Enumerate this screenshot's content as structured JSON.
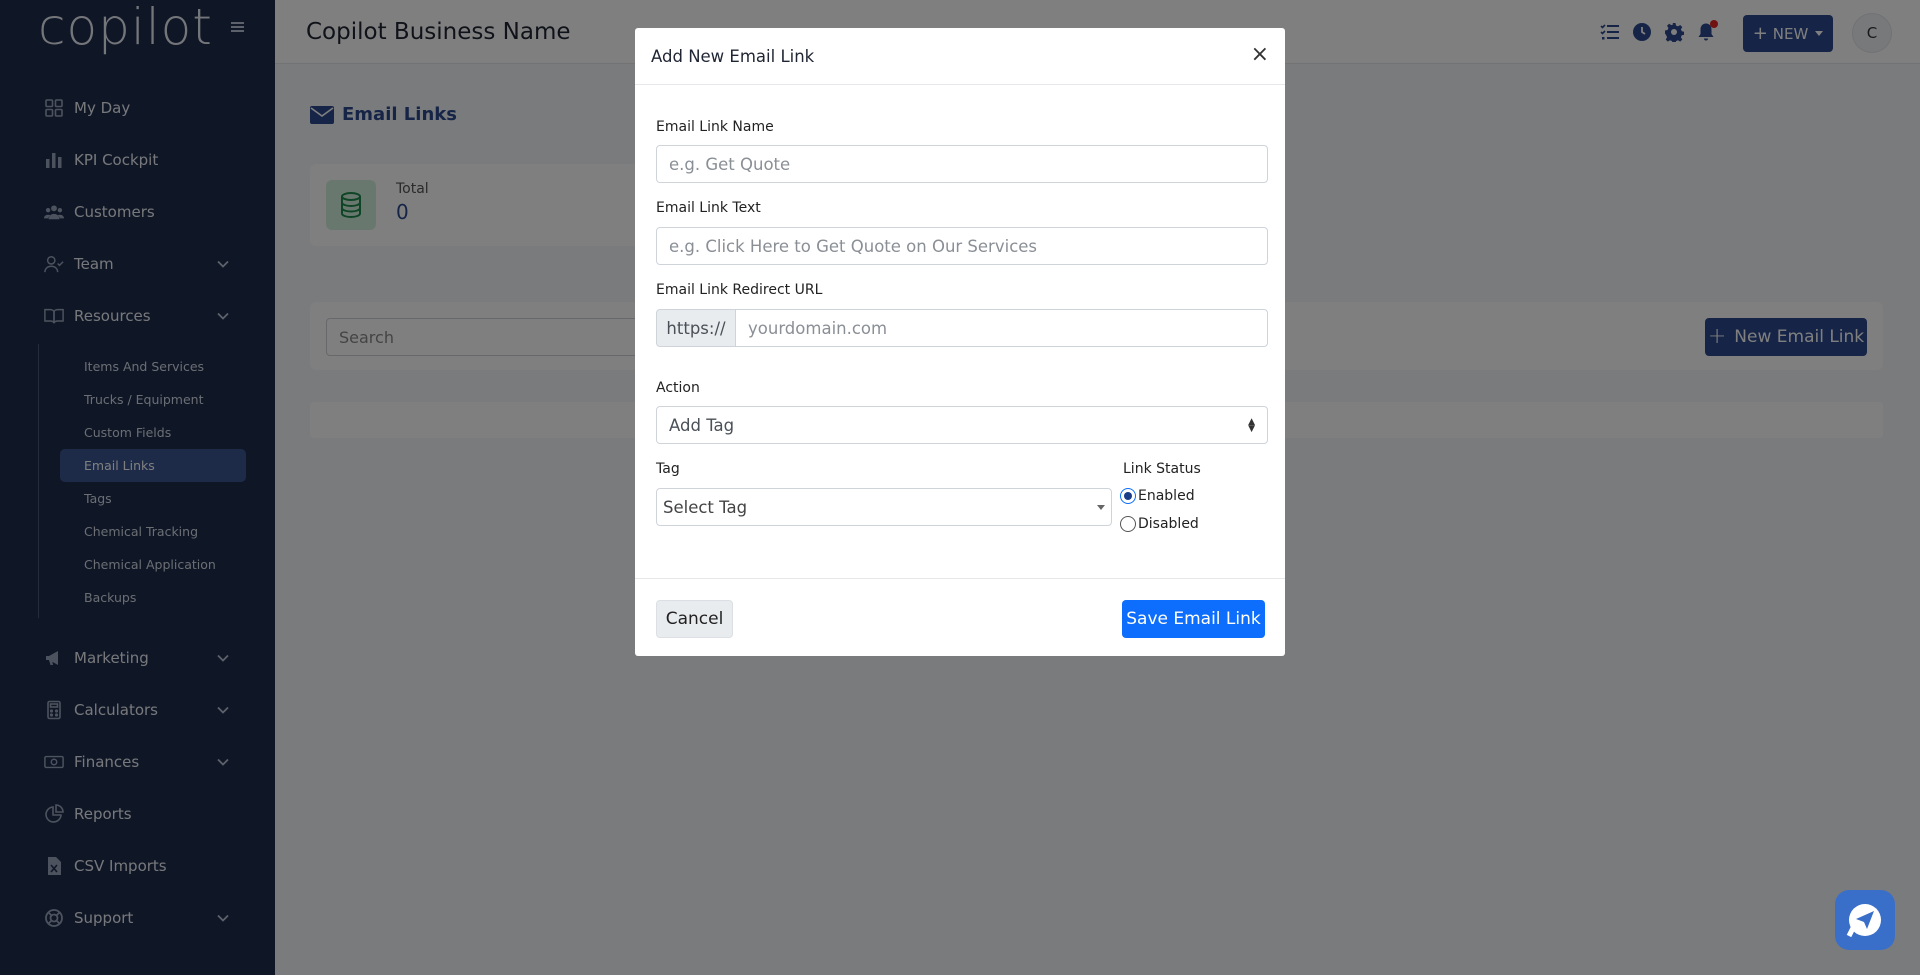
{
  "sidebar": {
    "logo": "copilot",
    "items": [
      {
        "label": "My Day",
        "icon": "grid-icon"
      },
      {
        "label": "KPI Cockpit",
        "icon": "bar-chart-icon"
      },
      {
        "label": "Customers",
        "icon": "users-icon"
      },
      {
        "label": "Team",
        "icon": "user-icon"
      },
      {
        "label": "Resources",
        "icon": "book-icon"
      }
    ],
    "resources_sub": [
      "Items And Services",
      "Trucks / Equipment",
      "Custom Fields",
      "Email Links",
      "Tags",
      "Chemical Tracking",
      "Chemical Application",
      "Backups"
    ],
    "items_after": [
      {
        "label": "Marketing",
        "icon": "megaphone-icon"
      },
      {
        "label": "Calculators",
        "icon": "calculator-icon"
      },
      {
        "label": "Finances",
        "icon": "money-icon"
      },
      {
        "label": "Reports",
        "icon": "pie-chart-icon"
      },
      {
        "label": "CSV Imports",
        "icon": "csv-file-icon"
      },
      {
        "label": "Support",
        "icon": "lifebuoy-icon"
      }
    ]
  },
  "topbar": {
    "business_name": "Copilot Business Name",
    "new_label": "NEW",
    "avatar_initial": "C"
  },
  "main": {
    "title": "Email Links",
    "stat_label": "Total",
    "stat_value": "0",
    "search_placeholder": "Search",
    "new_email_link_label": "New Email Link"
  },
  "modal": {
    "title": "Add New Email Link",
    "close": "×",
    "name_label": "Email Link Name",
    "name_placeholder": "e.g. Get Quote",
    "text_label": "Email Link Text",
    "text_placeholder": "e.g. Click Here to Get Quote on Our Services",
    "url_label": "Email Link Redirect URL",
    "url_prefix": "https://",
    "url_placeholder": "yourdomain.com",
    "action_label": "Action",
    "action_value": "Add Tag",
    "tag_label": "Tag",
    "tag_placeholder": "Select Tag",
    "status_label": "Link Status",
    "status_enabled": "Enabled",
    "status_disabled": "Disabled",
    "cancel_label": "Cancel",
    "save_label": "Save Email Link"
  }
}
